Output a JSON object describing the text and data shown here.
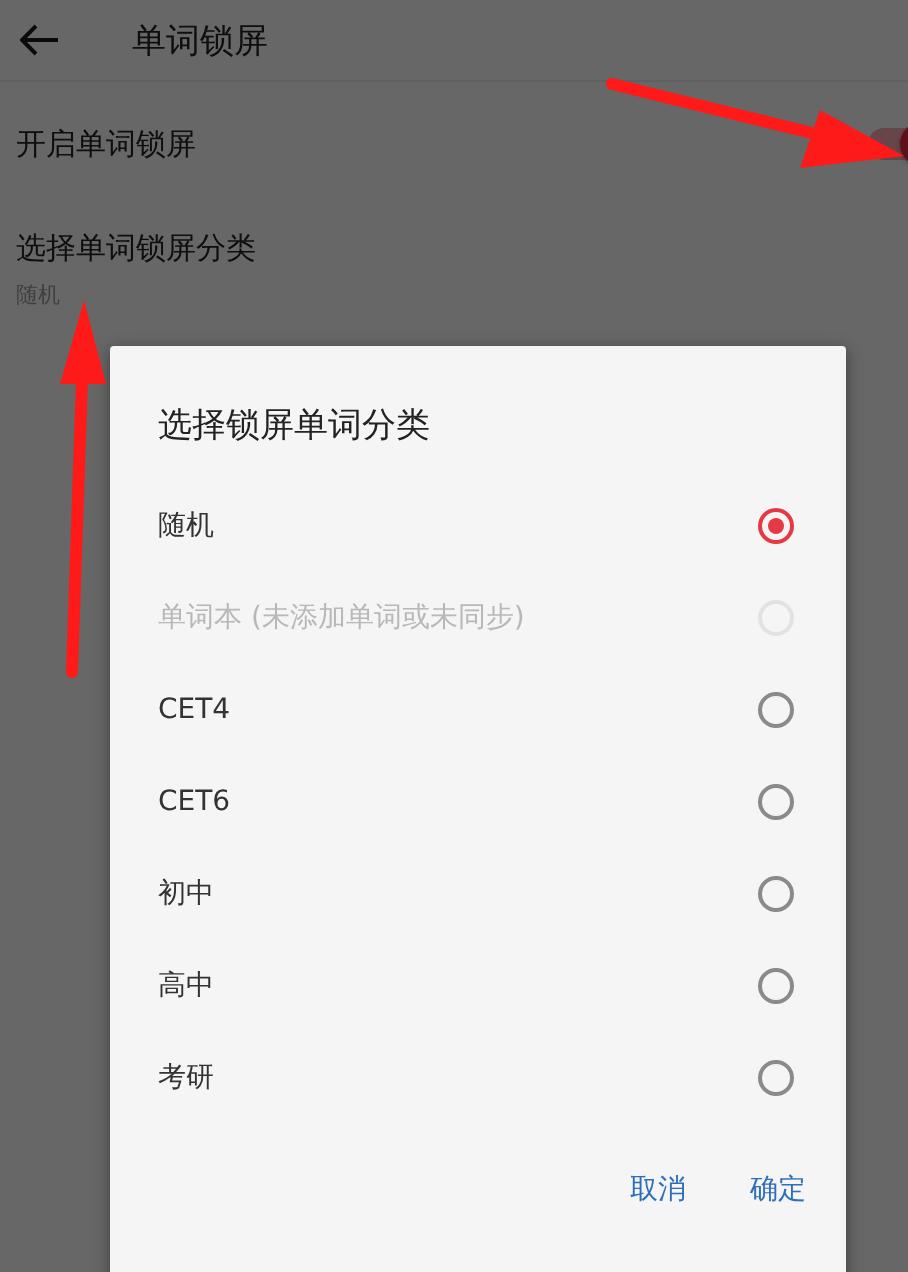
{
  "app_bar": {
    "title": "单词锁屏"
  },
  "settings": [
    {
      "kind": "toggle",
      "label": "开启单词锁屏",
      "on": true
    },
    {
      "kind": "select",
      "label": "选择单词锁屏分类",
      "value": "随机"
    }
  ],
  "dialog": {
    "title": "选择锁屏单词分类",
    "options": [
      {
        "label": "随机",
        "selected": true,
        "disabled": false
      },
      {
        "label": "单词本 (未添加单词或未同步)",
        "selected": false,
        "disabled": true
      },
      {
        "label": "CET4",
        "selected": false,
        "disabled": false
      },
      {
        "label": "CET6",
        "selected": false,
        "disabled": false
      },
      {
        "label": "初中",
        "selected": false,
        "disabled": false
      },
      {
        "label": "高中",
        "selected": false,
        "disabled": false
      },
      {
        "label": "考研",
        "selected": false,
        "disabled": false
      }
    ],
    "buttons": [
      "取消",
      "确定"
    ]
  }
}
